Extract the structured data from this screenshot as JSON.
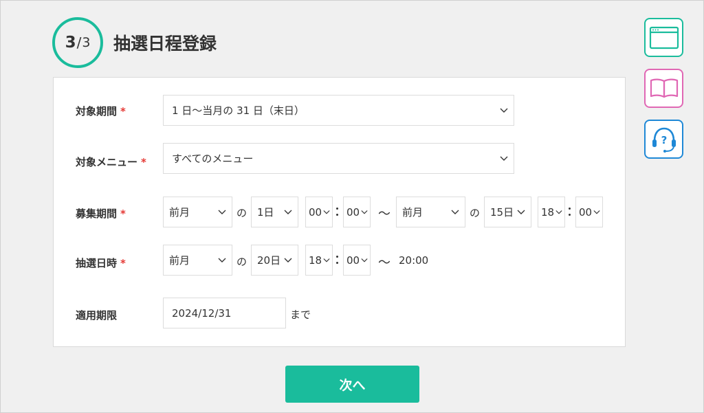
{
  "header": {
    "step_current": "3",
    "step_separator": "/",
    "step_total": "3",
    "title": "抽選日程登録"
  },
  "form": {
    "target_period": {
      "label": "対象期間",
      "required_mark": "*",
      "value": "1 日〜当月の 31 日（末日）"
    },
    "target_menu": {
      "label": "対象メニュー",
      "required_mark": "*",
      "value": "すべてのメニュー"
    },
    "recruit_period": {
      "label": "募集期間",
      "required_mark": "*",
      "start_month": "前月",
      "no1": "の",
      "start_day": "1日",
      "start_hour": "00",
      "start_minute": "00",
      "tilde": "〜",
      "end_month": "前月",
      "no2": "の",
      "end_day": "15日",
      "end_hour": "18",
      "end_minute": "00"
    },
    "lottery_datetime": {
      "label": "抽選日時",
      "required_mark": "*",
      "month": "前月",
      "no": "の",
      "day": "20日",
      "hour": "18",
      "minute": "00",
      "tilde": "〜",
      "end_time": "20:00"
    },
    "valid_until": {
      "label": "適用期限",
      "value": "2024/12/31",
      "suffix": "まで"
    }
  },
  "next_button": {
    "label": "次へ"
  },
  "side_icons": [
    {
      "icon": "browser-window-icon",
      "color": "#1abc9c"
    },
    {
      "icon": "open-book-icon",
      "color": "#e067b4"
    },
    {
      "icon": "support-headset-icon",
      "color": "#1e88d6"
    }
  ],
  "colors": {
    "accent": "#1abc9c",
    "required": "#e53935",
    "background": "#f0f0f0"
  }
}
